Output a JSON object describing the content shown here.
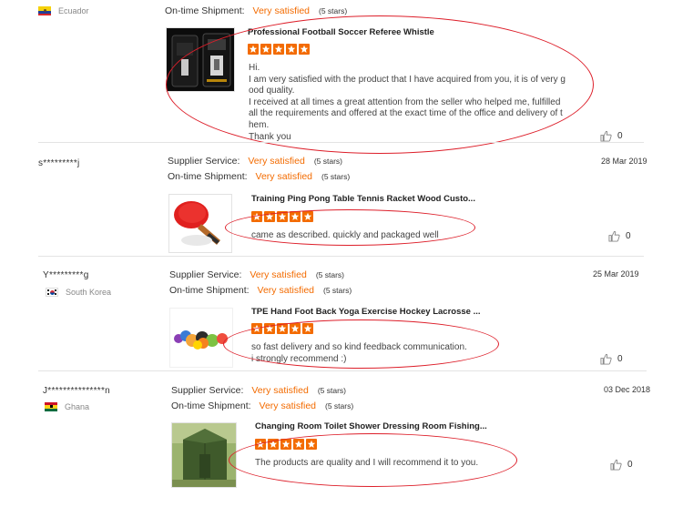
{
  "reviews": [
    {
      "country": "Ecuador",
      "flag": "ecuador",
      "ratings": [
        {
          "label": "On-time Shipment:",
          "value": "Very satisfied",
          "stars": "(5 stars)"
        }
      ],
      "product_title": "Professional Football Soccer Referee Whistle",
      "product_image": "phone-case-image",
      "text_lines": [
        "Hi.",
        "I am very satisfied with the product that I have acquired from you, it is of very g",
        "ood quality.",
        "I received at all times a great attention from the seller who helped me, fulfilled",
        "all the requirements and offered at the exact time of the office and delivery of t",
        "hem.",
        "Thank you"
      ],
      "helpful_count": "0"
    },
    {
      "buyer": "s*********j",
      "date": "28 Mar 2019",
      "ratings": [
        {
          "label": "Supplier Service:",
          "value": "Very satisfied",
          "stars": "(5 stars)"
        },
        {
          "label": "On-time Shipment:",
          "value": "Very satisfied",
          "stars": "(5 stars)"
        }
      ],
      "product_title": "Training Ping Pong Table Tennis Racket Wood Custo...",
      "product_image": "ping-pong-paddle-image",
      "text_lines": [
        "came as described. quickly and packaged well"
      ],
      "helpful_count": "0"
    },
    {
      "buyer": "Y*********g",
      "date": "25 Mar 2019",
      "country": "South Korea",
      "flag": "south-korea",
      "ratings": [
        {
          "label": "Supplier Service:",
          "value": "Very satisfied",
          "stars": "(5 stars)"
        },
        {
          "label": "On-time Shipment:",
          "value": "Very satisfied",
          "stars": "(5 stars)"
        }
      ],
      "product_title": "TPE Hand Foot Back Yoga Exercise Hockey Lacrosse ...",
      "product_image": "massage-balls-image",
      "text_lines": [
        "so fast delivery and so kind feedback communication.",
        "i strongly recommend :)"
      ],
      "helpful_count": "0"
    },
    {
      "buyer": "J***************n",
      "date": "03 Dec 2018",
      "country": "Ghana",
      "flag": "ghana",
      "ratings": [
        {
          "label": "Supplier Service:",
          "value": "Very satisfied",
          "stars": "(5 stars)"
        },
        {
          "label": "On-time Shipment:",
          "value": "Very satisfied",
          "stars": "(5 stars)"
        }
      ],
      "product_title": "Changing Room Toilet Shower Dressing Room Fishing...",
      "product_image": "changing-tent-image",
      "text_lines": [
        "The products are quality and I will recommend it to you."
      ],
      "helpful_count": "0"
    }
  ],
  "colors": {
    "accent": "#f36b00",
    "annotation": "#dd1f2a",
    "divider": "#e4e4e4"
  }
}
